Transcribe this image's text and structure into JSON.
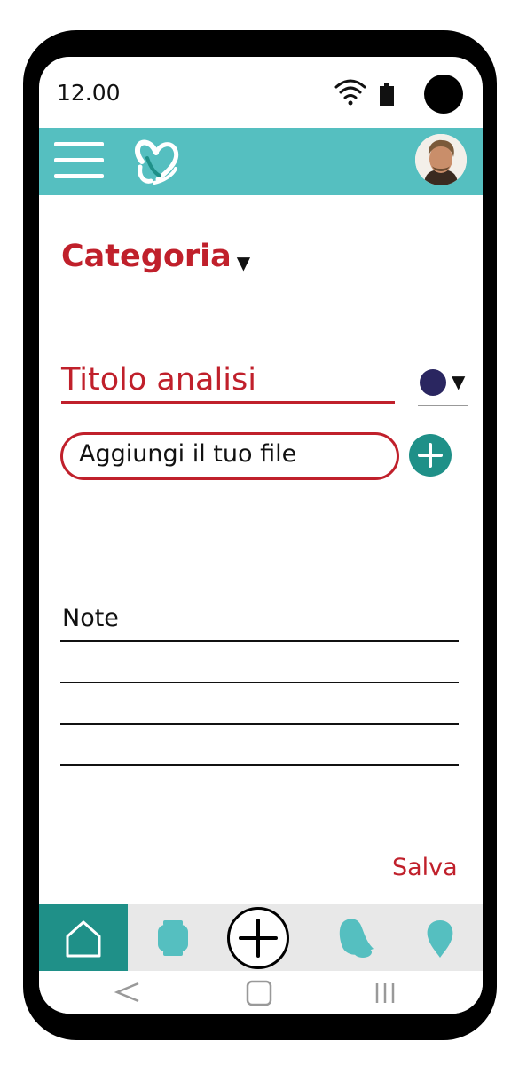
{
  "status_bar": {
    "time": "12.00"
  },
  "header": {
    "menu_icon": "hamburger-menu-icon",
    "logo_icon": "heart-hands-logo",
    "avatar_icon": "user-avatar"
  },
  "form": {
    "category_label": "Categoria",
    "title_placeholder": "Titolo analisi",
    "color_value": "#2a2660",
    "file_placeholder": "Aggiungi il tuo file",
    "notes_label": "Note",
    "save_label": "Salva"
  },
  "bottom_nav": {
    "items": [
      "home-icon",
      "watch-icon",
      "add-icon",
      "bell-icon",
      "map-pin-icon"
    ],
    "active": "home"
  },
  "colors": {
    "accent": "#55bfc0",
    "accent_dark": "#1f9088",
    "primary_red": "#c0202b"
  }
}
